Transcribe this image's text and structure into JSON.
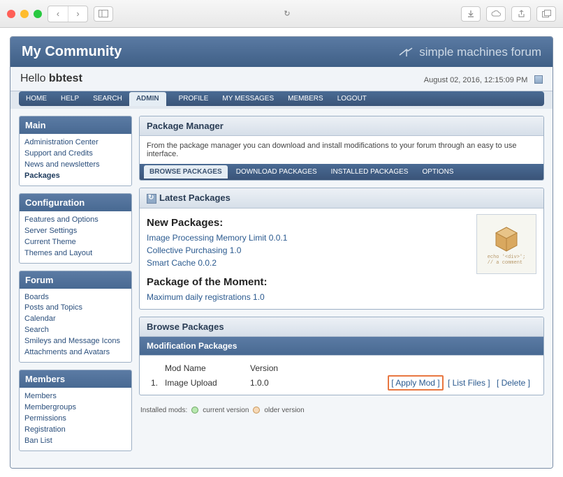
{
  "header": {
    "community": "My Community",
    "brand": "simple machines forum"
  },
  "userbar": {
    "hello_prefix": "Hello ",
    "username": "bbtest",
    "datetime": "August 02, 2016, 12:15:09 PM"
  },
  "topmenu": {
    "home": "HOME",
    "help": "HELP",
    "search": "SEARCH",
    "admin": "ADMIN",
    "profile": "PROFILE",
    "my_messages": "MY MESSAGES",
    "members": "MEMBERS",
    "logout": "LOGOUT"
  },
  "sidebar": {
    "main": {
      "title": "Main",
      "items": [
        "Administration Center",
        "Support and Credits",
        "News and newsletters",
        "Packages"
      ],
      "current_index": 3
    },
    "configuration": {
      "title": "Configuration",
      "items": [
        "Features and Options",
        "Server Settings",
        "Current Theme",
        "Themes and Layout"
      ]
    },
    "forum": {
      "title": "Forum",
      "items": [
        "Boards",
        "Posts and Topics",
        "Calendar",
        "Search",
        "Smileys and Message Icons",
        "Attachments and Avatars"
      ]
    },
    "members": {
      "title": "Members",
      "items": [
        "Members",
        "Membergroups",
        "Permissions",
        "Registration",
        "Ban List"
      ]
    }
  },
  "package_manager": {
    "title": "Package Manager",
    "description": "From the package manager you can download and install modifications to your forum through an easy to use interface.",
    "tabs": {
      "browse": "BROWSE PACKAGES",
      "download": "DOWNLOAD PACKAGES",
      "installed": "INSTALLED PACKAGES",
      "options": "OPTIONS"
    }
  },
  "latest": {
    "title": "Latest Packages",
    "new_heading": "New Packages:",
    "new_items": [
      "Image Processing Memory Limit 0.0.1",
      "Collective Purchasing 1.0",
      "Smart Cache 0.0.2"
    ],
    "moment_heading": "Package of the Moment:",
    "moment_item": "Maximum daily registrations 1.0",
    "box_line1": "echo '<div>';",
    "box_line2": "// a comment"
  },
  "browse": {
    "title": "Browse Packages",
    "subtitle": "Modification Packages",
    "col_name": "Mod Name",
    "col_version": "Version",
    "rows": [
      {
        "num": "1.",
        "name": "Image Upload",
        "version": "1.0.0"
      }
    ],
    "actions": {
      "apply": "[ Apply Mod ]",
      "list": "[ List Files ]",
      "delete": "[ Delete ]"
    },
    "legend": {
      "label": "Installed mods:",
      "current": "current version",
      "older": "older version"
    }
  }
}
